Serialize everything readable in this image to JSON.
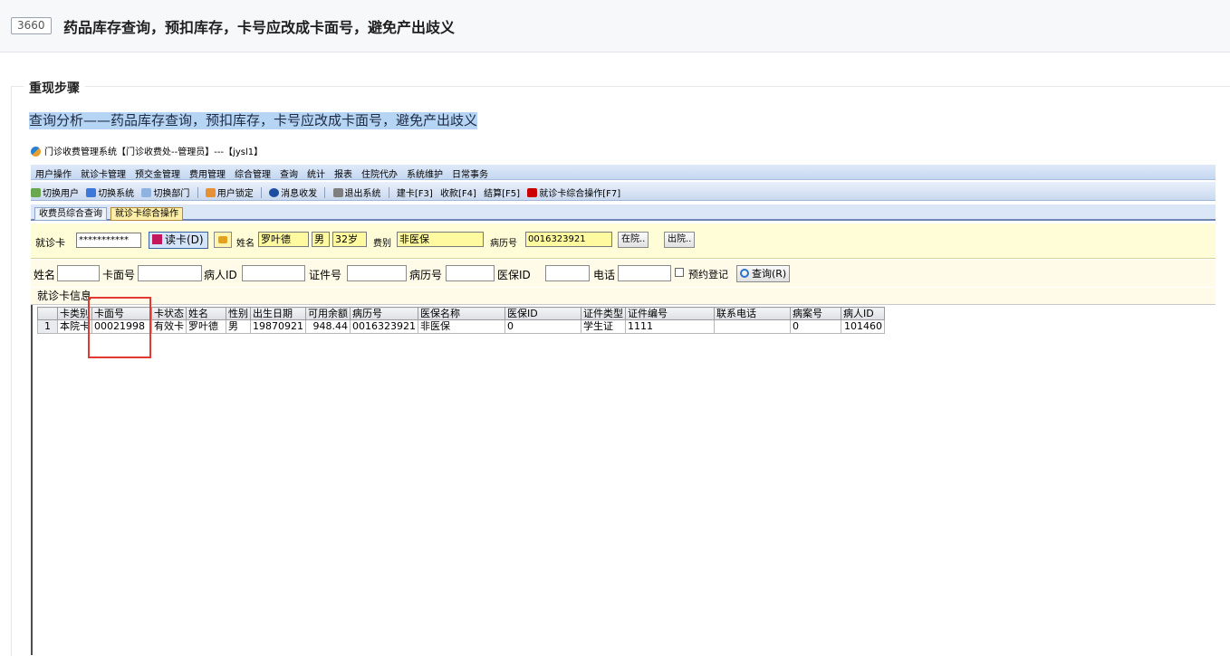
{
  "issue": {
    "id": "3660",
    "title": "药品库存查询，预扣库存，卡号应改成卡面号，避免产出歧义"
  },
  "section": {
    "title": "重现步骤",
    "description": "查询分析——药品库存查询，预扣库存，卡号应改成卡面号，避免产出歧义"
  },
  "app": {
    "window_title": "门诊收费管理系统【门诊收费处--管理员】---【jysl1】",
    "menu": [
      "用户操作",
      "就诊卡管理",
      "预交金管理",
      "费用管理",
      "综合管理",
      "查询",
      "统计",
      "报表",
      "住院代办",
      "系统维护",
      "日常事务"
    ],
    "toolbar": [
      "切换用户",
      "切换系统",
      "切换部门",
      "用户锁定",
      "消息收发",
      "退出系统",
      "建卡[F3]",
      "收款[F4]",
      "结算[F5]",
      "就诊卡综合操作[F7]"
    ],
    "tabs": [
      "收费员综合查询",
      "就诊卡综合操作"
    ],
    "card": {
      "card_label": "就诊卡",
      "card_value": "***********",
      "read_btn": "读卡(D)",
      "name_label": "姓名",
      "name_value": "罗叶德",
      "gender_value": "男",
      "age_value": "32岁",
      "fee_label": "费别",
      "fee_value": "非医保",
      "record_label": "病历号",
      "record_value": "0016323921",
      "in_hosp_btn": "在院..",
      "out_hosp_btn": "出院.."
    },
    "query": {
      "name_label": "姓名",
      "card_face_label": "卡面号",
      "patient_id_label": "病人ID",
      "cert_label": "证件号",
      "record_label": "病历号",
      "insurance_label": "医保ID",
      "phone_label": "电话",
      "appointment_label": "预约登记",
      "query_btn": "查询(R)"
    },
    "info_title": "就诊卡信息",
    "grid": {
      "headers": [
        "",
        "卡类别",
        "卡面号",
        "卡状态",
        "姓名",
        "性别",
        "出生日期",
        "可用余额",
        "病历号",
        "医保名称",
        "医保ID",
        "证件类型",
        "证件编号",
        "联系电话",
        "病案号",
        "病人ID"
      ],
      "rows": [
        [
          "1",
          "本院卡",
          "00021998",
          "有效卡",
          "罗叶德",
          "男",
          "19870921",
          "948.44",
          "0016323921",
          "非医保",
          "0",
          "学生证",
          "1111",
          "",
          "0",
          "101460"
        ]
      ]
    }
  },
  "colors": {
    "highlight_box": "#e23a32",
    "description_bg": "#b6d4f4",
    "card_row_bg": "#fffdd7"
  }
}
